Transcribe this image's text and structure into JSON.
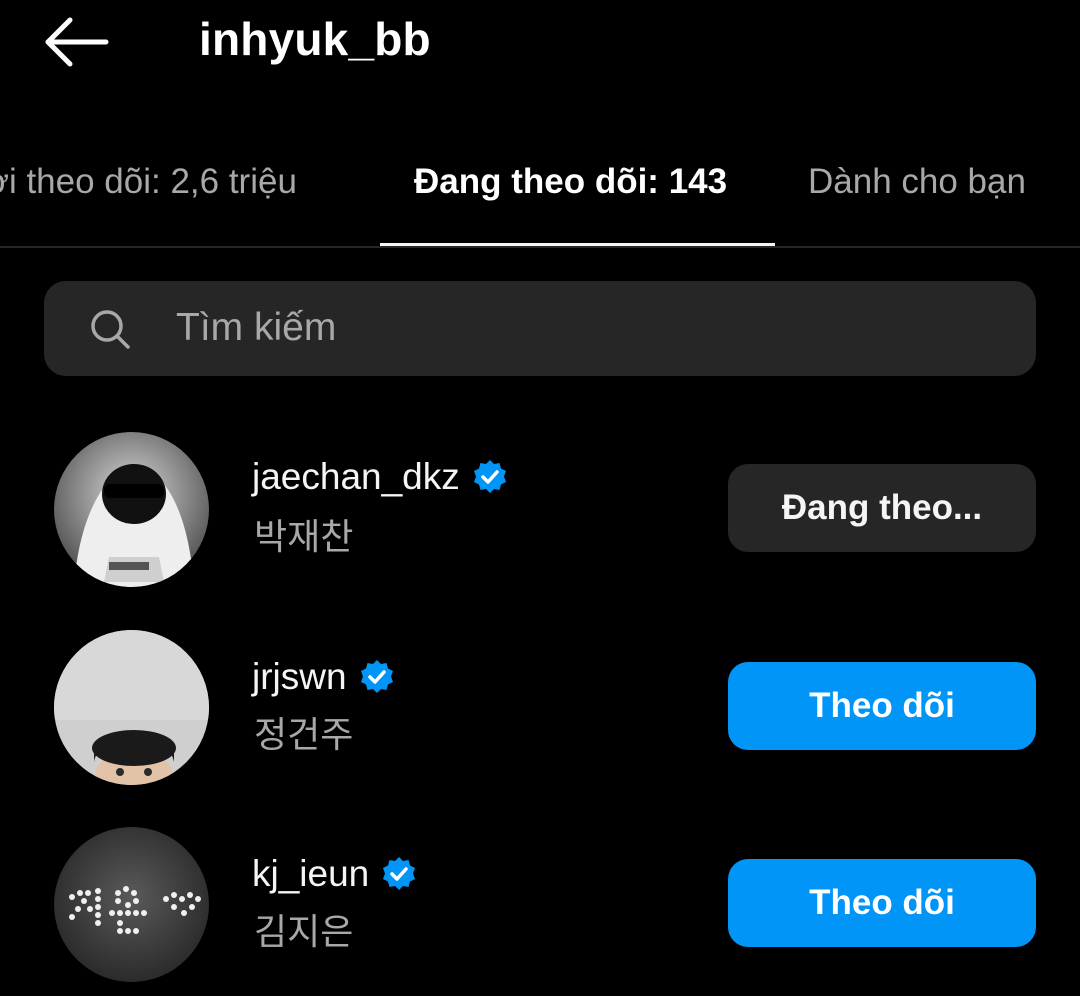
{
  "header": {
    "title": "inhyuk_bb",
    "back_icon": "arrow-left-icon"
  },
  "tabs": [
    {
      "label": "ời theo dõi: 2,6 triệu",
      "active": false
    },
    {
      "label": "Đang theo dõi: 143",
      "active": true
    },
    {
      "label": "Dành cho bạn",
      "active": false
    }
  ],
  "search": {
    "placeholder": "Tìm kiếm",
    "icon": "search-icon"
  },
  "accounts": [
    {
      "username": "jaechan_dkz",
      "full_name": "박재찬",
      "verified": true,
      "button_label": "Đang theo...",
      "button_state": "following"
    },
    {
      "username": "jrjswn",
      "full_name": "정건주",
      "verified": true,
      "button_label": "Theo dõi",
      "button_state": "follow"
    },
    {
      "username": "kj_ieun",
      "full_name": "김지은",
      "verified": true,
      "button_label": "Theo dõi",
      "button_state": "follow"
    }
  ],
  "colors": {
    "background": "#000000",
    "accent_blue": "#0095f6",
    "secondary_text": "#a8a8a8",
    "surface": "#262626"
  }
}
